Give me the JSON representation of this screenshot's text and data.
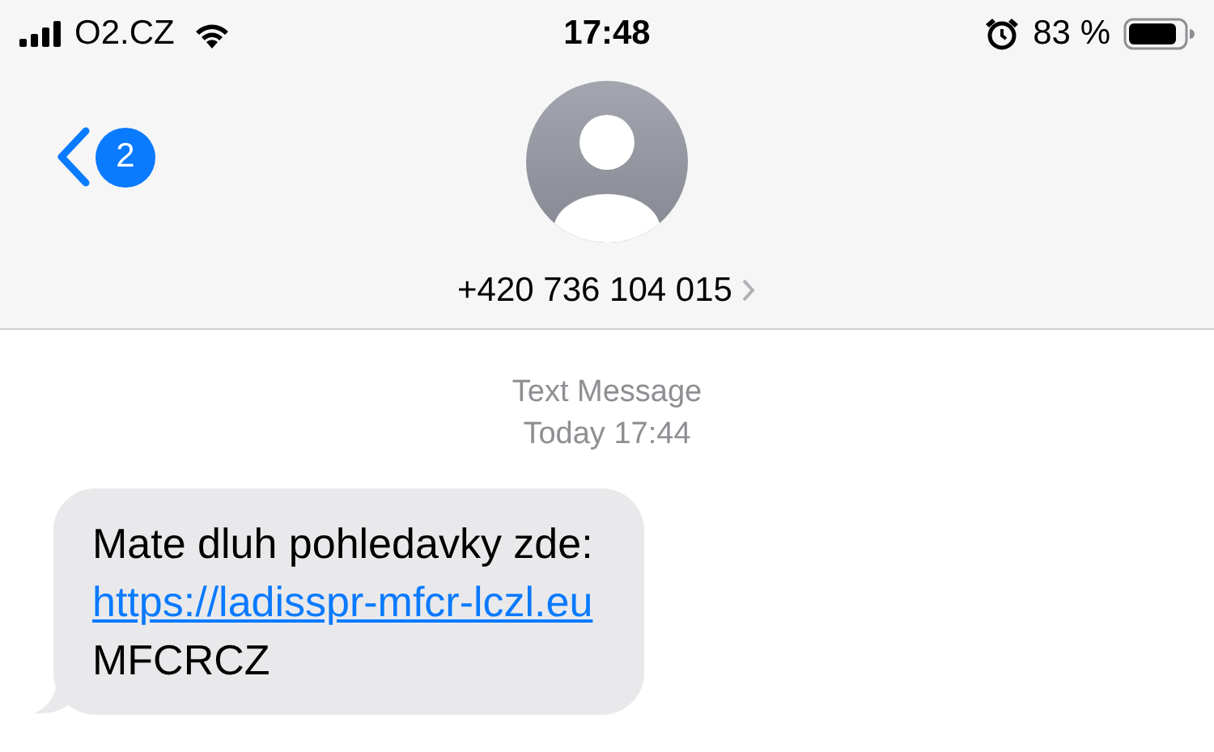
{
  "status_bar": {
    "carrier": "O2.CZ",
    "time": "17:48",
    "battery": "83 %"
  },
  "header": {
    "back_badge": "2",
    "contact": "+420 736 104 015"
  },
  "thread": {
    "service": "Text Message",
    "timestamp": "Today 17:44",
    "messages": [
      {
        "parts": [
          {
            "kind": "text",
            "text": "Mate dluh pohledavky zde:"
          },
          {
            "kind": "link",
            "text": "https://ladisspr-mfcr-lczl.eu"
          },
          {
            "kind": "text",
            "text": "MFCRCZ"
          }
        ]
      }
    ]
  }
}
